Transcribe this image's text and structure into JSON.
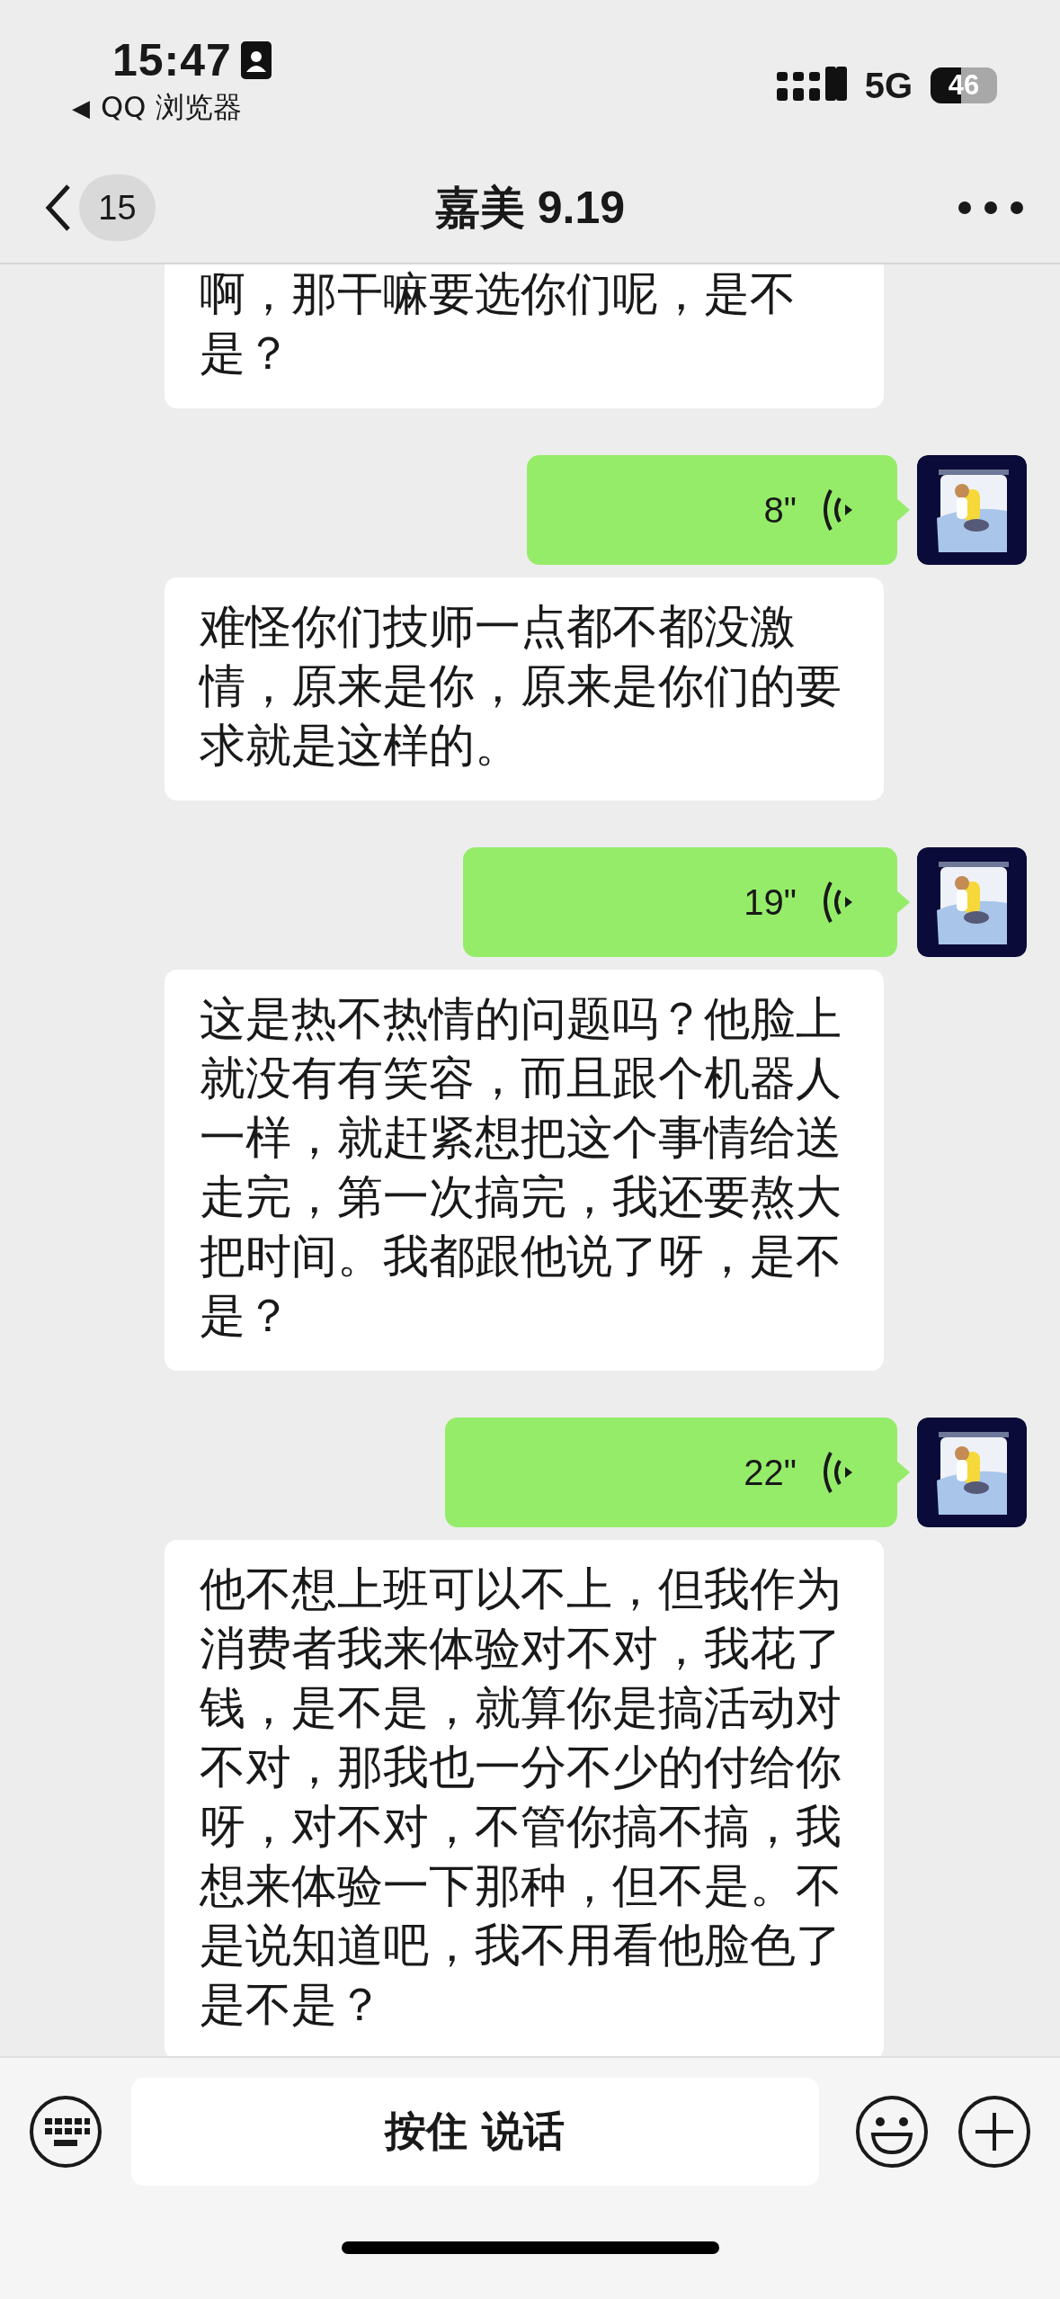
{
  "status_bar": {
    "time": "15:47",
    "back_app": {
      "arrow": "◀",
      "label": "QQ 浏览器"
    },
    "network": "5G",
    "battery": "46"
  },
  "nav": {
    "unread_count": "15",
    "title": "嘉美 9.19"
  },
  "messages": [
    {
      "kind": "text",
      "text": "啊，那干嘛要选你们呢，是不是？"
    },
    {
      "kind": "voice",
      "duration": "8\""
    },
    {
      "kind": "text",
      "text": "难怪你们技师一点都不都没激情，原来是你，原来是你们的要求就是这样的。"
    },
    {
      "kind": "voice",
      "duration": "19\""
    },
    {
      "kind": "text",
      "text": "这是热不热情的问题吗？他脸上就没有有笑容，而且跟个机器人一样，就赶紧想把这个事情给送走完，第一次搞完，我还要熬大把时间。我都跟他说了呀，是不是？"
    },
    {
      "kind": "voice",
      "duration": "22\""
    },
    {
      "kind": "text",
      "text": "他不想上班可以不上，但我作为消费者我来体验对不对，我花了钱，是不是，就算你是搞活动对不对，那我也一分不少的付给你呀，对不对，不管你搞不搞，我想来体验一下那种，但不是。不是说知道吧，我不用看他脸色了是不是？"
    }
  ],
  "input_bar": {
    "hold_to_talk": "按住 说话"
  }
}
